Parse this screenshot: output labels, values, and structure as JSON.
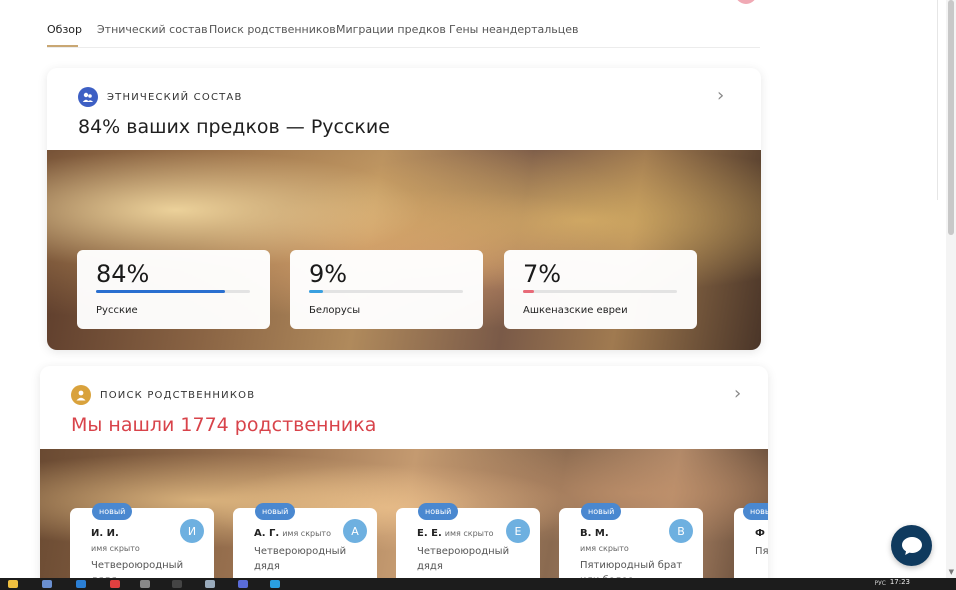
{
  "tabs": [
    {
      "label": "Обзор",
      "active": true
    },
    {
      "label": "Этнический состав",
      "active": false
    },
    {
      "label": "Поиск родственников",
      "active": false
    },
    {
      "label": "Миграции предков",
      "active": false
    },
    {
      "label": "Гены неандертальцев",
      "active": false
    }
  ],
  "ethnic": {
    "section_label": "ЭТНИЧЕСКИЙ СОСТАВ",
    "headline": "84% ваших предков — Русские",
    "stats": [
      {
        "pct": "84%",
        "value": 84,
        "label": "Русские",
        "color": "#2a6fd0"
      },
      {
        "pct": "9%",
        "value": 9,
        "label": "Белорусы",
        "color": "#3aa0e0"
      },
      {
        "pct": "7%",
        "value": 7,
        "label": "Ашкеназские евреи",
        "color": "#e86a78"
      }
    ]
  },
  "relatives": {
    "section_label": "ПОИСК РОДСТВЕННИКОВ",
    "headline": "Мы нашли 1774 родственника",
    "badge": "новый",
    "hidden_text": "имя скрыто",
    "cards": [
      {
        "name": "И. И.",
        "initial": "И",
        "hidden_inline": false,
        "kin": "Четвероюродный дядя"
      },
      {
        "name": "А. Г.",
        "initial": "А",
        "hidden_inline": true,
        "kin": "Четвероюродный дядя"
      },
      {
        "name": "Е. Е.",
        "initial": "Е",
        "hidden_inline": true,
        "kin": "Четвероюродный дядя"
      },
      {
        "name": "В. М.",
        "initial": "В",
        "hidden_inline": false,
        "kin": "Пятиюродный брат или более"
      },
      {
        "name": "Ф Г",
        "initial": "",
        "hidden_inline": false,
        "kin": "Пятиюродный брат"
      }
    ]
  },
  "taskbar": {
    "clock": "17:23",
    "lang": "РУС"
  },
  "colors": {
    "accent_gold": "#c9a773",
    "headline_red": "#d8434a",
    "badge_blue": "#4a88d0",
    "chat_navy": "#0f3a5e"
  },
  "icons": {
    "ethnic": "people-icon",
    "relatives": "person-icon",
    "chevron": "chevron-right-icon",
    "chat": "chat-bubble-icon"
  }
}
